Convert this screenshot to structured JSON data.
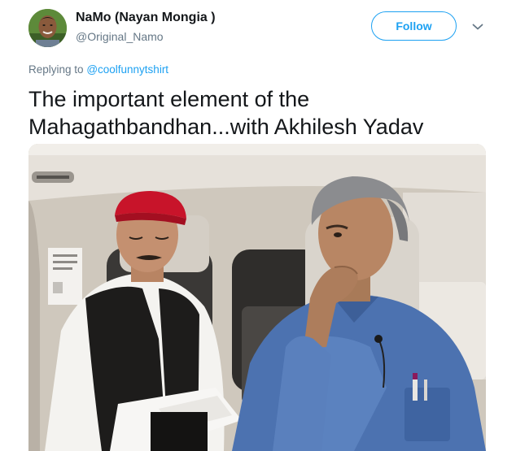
{
  "author": {
    "display_name": "NaMo (Nayan Mongia )",
    "handle": "@Original_Namo",
    "avatar_icon": "user-avatar"
  },
  "follow_label": "Follow",
  "menu_icon": "chevron-down-icon",
  "reply": {
    "prefix": "Replying to",
    "mention": "@coolfunnytshirt"
  },
  "tweet_text": "The important element of the Mahagathbandhan...with Akhilesh Yadav",
  "colors": {
    "accent": "#1da1f2",
    "secondary_text": "#657786",
    "primary_text": "#14171a"
  }
}
